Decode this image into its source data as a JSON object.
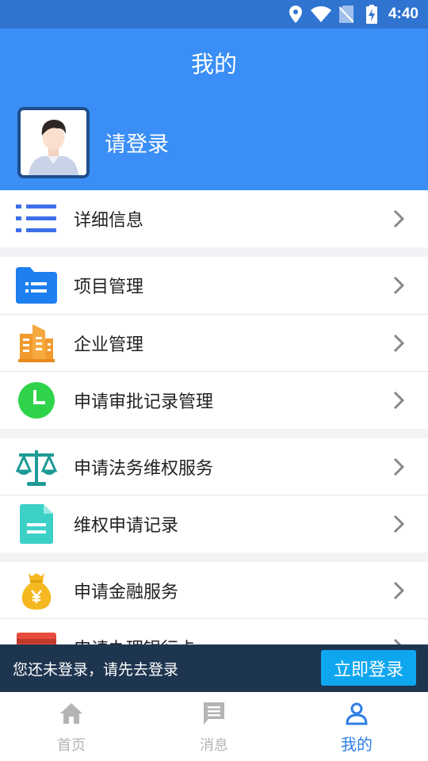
{
  "status_bar": {
    "time": "4:40"
  },
  "header": {
    "title": "我的",
    "login_prompt": "请登录"
  },
  "menu": {
    "details": "详细信息",
    "project_mgmt": "项目管理",
    "enterprise_mgmt": "企业管理",
    "approval_records": "申请审批记录管理",
    "legal_service": "申请法务维权服务",
    "rights_records": "维权申请记录",
    "finance_service": "申请金融服务",
    "bank_card": "申请办理银行卡"
  },
  "toast": {
    "message": "您还未登录，请先去登录",
    "button": "立即登录"
  },
  "tabs": {
    "home": "首页",
    "messages": "消息",
    "mine": "我的"
  },
  "colors": {
    "primary": "#3a8ef5",
    "status_bar": "#2f74d0",
    "toast_bg": "#1e3550",
    "toast_button": "#0fa6f0",
    "active_tab": "#2f7fe6"
  }
}
